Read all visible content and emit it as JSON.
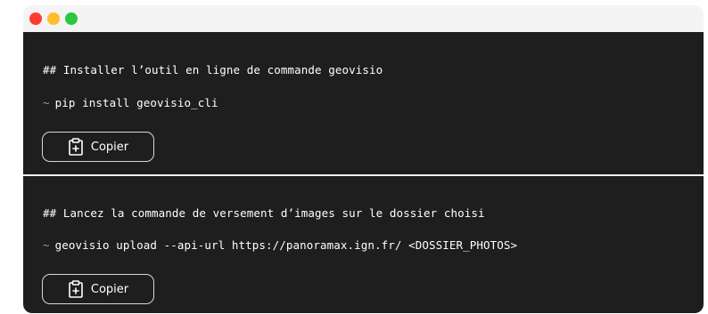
{
  "window": {
    "controls": [
      {
        "name": "close",
        "color": "#ff3b30"
      },
      {
        "name": "minimize",
        "color": "#ffbd2e"
      },
      {
        "name": "maximize",
        "color": "#28c840"
      }
    ]
  },
  "blocks": [
    {
      "comment": "## Installer l’outil en ligne de commande geovisio",
      "prompt": "~",
      "command": "pip install geovisio_cli",
      "copy_icon": "clipboard-plus-icon",
      "copy_label": "Copier"
    },
    {
      "comment": "## Lancez la commande de versement d’images sur le dossier choisi",
      "prompt": "~",
      "command": "geovisio upload --api-url https://panoramax.ign.fr/ <DOSSIER_PHOTOS>",
      "copy_icon": "clipboard-plus-icon",
      "copy_label": "Copier"
    }
  ],
  "colors": {
    "terminal_bg": "#1e1e1e",
    "chrome_bg": "#f4f4f4",
    "prompt": "#9a9a9a"
  }
}
